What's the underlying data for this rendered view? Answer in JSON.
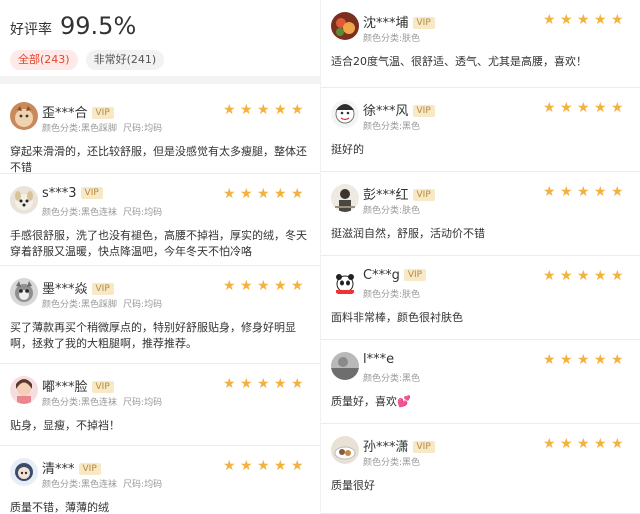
{
  "summary": {
    "rating_label": "好评率",
    "rating_value": "99.5%",
    "filters": [
      {
        "label": "全部(243)",
        "active": true
      },
      {
        "label": "非常好(241)",
        "active": false
      }
    ]
  },
  "reviews_left": [
    {
      "user": "歪***合",
      "vip": "VIP",
      "meta": [
        "颜色分类:黑色踩脚",
        "尺码:均码"
      ],
      "stars": 5,
      "text": "穿起来滑滑的，还比较舒服，但是没感觉有太多瘦腿，整体还不错",
      "avatar": "cat-avatar"
    },
    {
      "user": "s***3",
      "vip": "VIP",
      "meta": [
        "颜色分类:黑色连袜",
        "尺码:均码"
      ],
      "stars": 5,
      "text": "手感很舒服，洗了也没有褪色，高腰不掉裆，厚实的绒，冬天穿着舒服又温暖，快点降温吧，今年冬天不怕冷咯",
      "avatar": "dog-avatar"
    },
    {
      "user": "墨***焱",
      "vip": "VIP",
      "meta": [
        "颜色分类:黑色踩脚",
        "尺码:均码"
      ],
      "stars": 5,
      "text": "买了薄款再买个稍微厚点的，特别好舒服贴身，修身好明显啊，拯救了我的大粗腿啊，推荐推荐。",
      "avatar": "kitten-avatar"
    },
    {
      "user": "嘟***脸",
      "vip": "VIP",
      "meta": [
        "颜色分类:黑色连袜",
        "尺码:均码"
      ],
      "stars": 5,
      "text": "贴身，显瘦，不掉裆！",
      "avatar": "girl-avatar"
    },
    {
      "user": "清***",
      "vip": "VIP",
      "meta": [
        "颜色分类:黑色连袜",
        "尺码:均码"
      ],
      "stars": 5,
      "text": "质量不错，薄薄的绒",
      "avatar": "anime-avatar"
    }
  ],
  "reviews_right": [
    {
      "user": "沈***埔",
      "vip": "VIP",
      "meta": [
        "颜色分类:肤色"
      ],
      "stars": 5,
      "text": "适合20度气温、很舒适、透气、尤其是高腰，喜欢！",
      "avatar": "food-avatar"
    },
    {
      "user": "徐***风",
      "vip": "VIP",
      "meta": [
        "颜色分类:黑色"
      ],
      "stars": 5,
      "text": "挺好的",
      "avatar": "cartoon-avatar"
    },
    {
      "user": "彭***红",
      "vip": "VIP",
      "meta": [
        "颜色分类:肤色"
      ],
      "stars": 5,
      "text": "挺滋润自然，舒服，活动价不错",
      "avatar": "person-avatar"
    },
    {
      "user": "C***g",
      "vip": "VIP",
      "meta": [
        "颜色分类:肤色"
      ],
      "stars": 5,
      "text": "面料非常棒，颜色很衬肤色",
      "avatar": "panda-avatar"
    },
    {
      "user": "l***e",
      "vip": "",
      "meta": [
        "颜色分类:黑色"
      ],
      "stars": 5,
      "text": "质量好，喜欢💕",
      "avatar": "photo-avatar"
    },
    {
      "user": "孙***潇",
      "vip": "VIP",
      "meta": [
        "颜色分类:黑色"
      ],
      "stars": 5,
      "text": "质量很好",
      "avatar": "food2-avatar"
    }
  ],
  "colors": {
    "star": "#f3b23b",
    "active_chip_text": "#e8432d",
    "active_chip_bg": "#fde9e7",
    "vip_bg": "#f7e9c6",
    "vip_text": "#b5893f"
  }
}
